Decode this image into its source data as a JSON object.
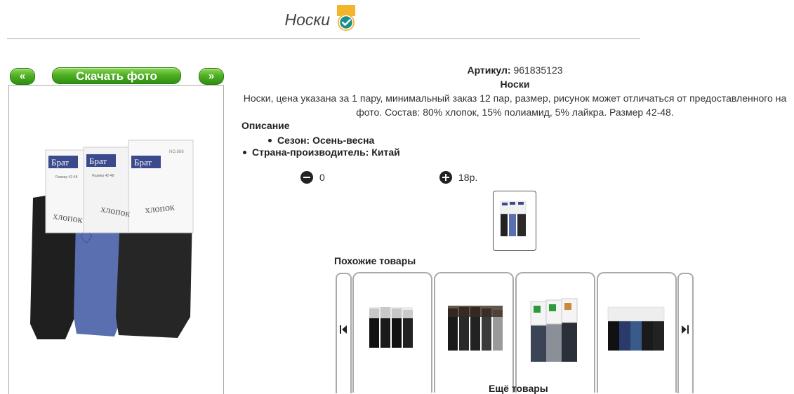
{
  "header": {
    "title": "Носки",
    "badge_icon": "verified-check-icon"
  },
  "photo_nav": {
    "prev_label": "«",
    "download_label": "Скачать фото",
    "next_label": "»"
  },
  "product": {
    "article_label": "Артикул:",
    "article_value": "961835123",
    "name": "Носки",
    "description": "Носки, цена указана за 1 пару, минимальный заказ 12 пар, размер, рисунок может отличаться от предоставленного на фото. Состав: 80% хлопок, 15% полиамид, 5% лайкра. Размер 42-48.",
    "description_heading": "Описание",
    "attributes": [
      "Сезон: Осень-весна",
      "Страна-производитель: Китай"
    ],
    "quantity": "0",
    "price": "18р."
  },
  "package_label": {
    "brand": "Брат",
    "material": "хлопок",
    "size": "Размер 42-48",
    "code": "NO.888"
  },
  "similar": {
    "title": "Похожие товары",
    "more_label": "Ещё товары"
  },
  "colors": {
    "accent_green": "#4fb024",
    "badge_gold": "#f3b52a",
    "badge_teal": "#1b8e8a"
  }
}
